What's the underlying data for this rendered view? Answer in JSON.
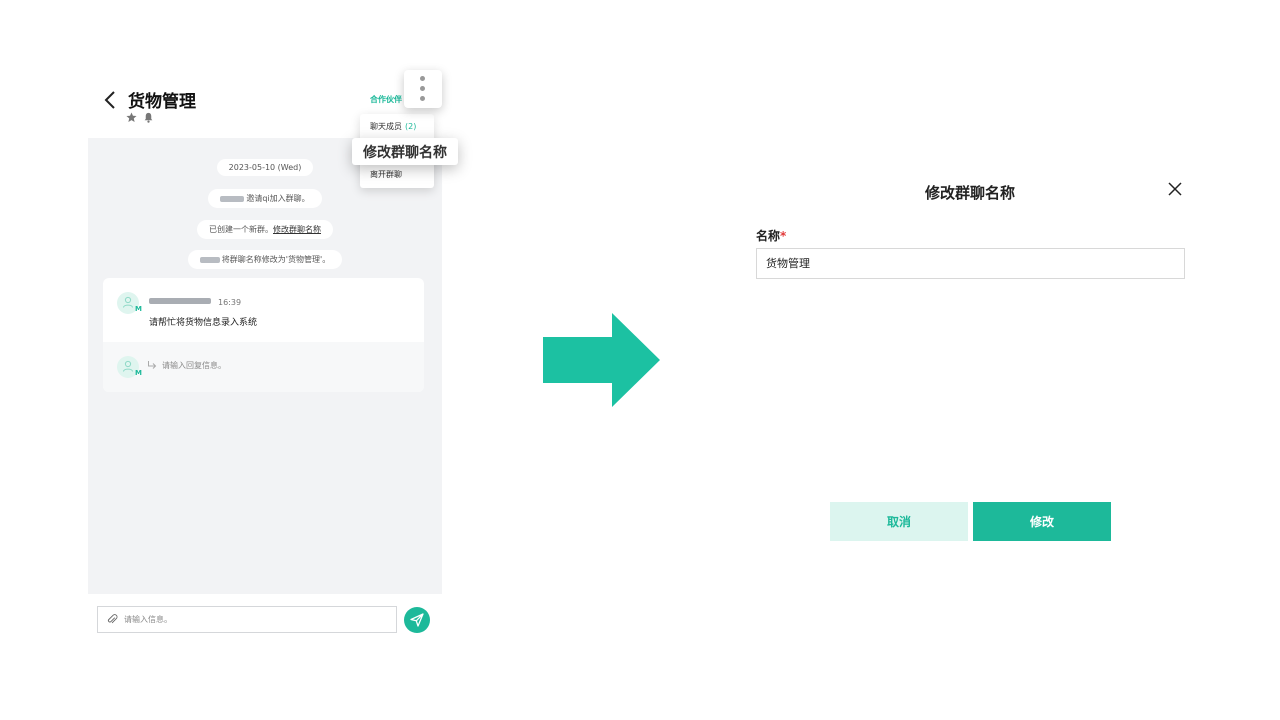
{
  "chat": {
    "title": "货物管理",
    "title_icons": [
      "star-icon",
      "bell-icon"
    ],
    "partner_link": "合作伙伴",
    "system_messages": {
      "date": "2023-05-10 (Wed)",
      "invite": "邀请qi加入群聊。",
      "created_prefix": "已创建一个新群。",
      "created_link": "修改群聊名称",
      "renamed": "将群聊名称修改为'货物管理'。"
    },
    "message": {
      "time": "16:39",
      "text": "请帮忙将货物信息录入系统",
      "avatar_badge": "M"
    },
    "reply": {
      "placeholder": "请输入回复信息。",
      "avatar_badge": "M"
    },
    "input_placeholder": "请输入信息。"
  },
  "menu": {
    "members_label": "聊天成员",
    "members_count": "(2)",
    "rename_label": "修改群聊名称",
    "leave_label": "离开群聊"
  },
  "dialog": {
    "title": "修改群聊名称",
    "field_label": "名称",
    "required_mark": "*",
    "name_value": "货物管理",
    "cancel_label": "取消",
    "submit_label": "修改"
  },
  "colors": {
    "accent": "#1db99a",
    "accent_light": "#dcf5ef",
    "chat_bg": "#f2f3f5"
  }
}
